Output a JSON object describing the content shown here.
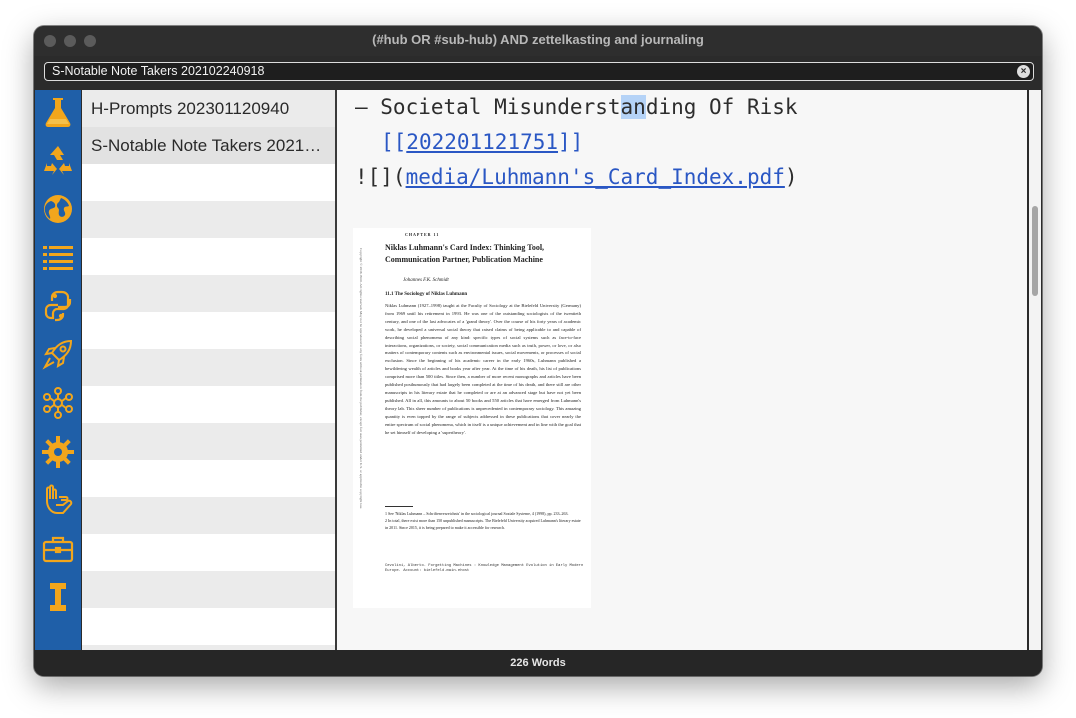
{
  "window": {
    "title": "(#hub OR #sub-hub) AND zettelkasting and journaling"
  },
  "search": {
    "value": "S-Notable Note Takers 202102240918",
    "clear_icon": "×"
  },
  "sidebar": {
    "icons": [
      "flask-icon",
      "recycle-icon",
      "globe-icon",
      "list-icon",
      "python-icon",
      "rocket-icon",
      "network-icon",
      "gear-icon",
      "hand-icon",
      "briefcase-icon",
      "letter-i-icon"
    ],
    "accent": "#1f5fa8",
    "icon_color": "#f2a61c"
  },
  "notes": {
    "items": [
      {
        "label": "H-Prompts 202301120940"
      },
      {
        "label": "S-Notable Note Takers 202102240918"
      }
    ]
  },
  "editor": {
    "line1_prefix": "– Societal Misunderst",
    "line1_selected": "an",
    "line1_suffix": "ding Of Risk",
    "line2_open": "[[",
    "line2_link": "202201121751",
    "line2_close": "]]",
    "line3_prefix": "![](",
    "line3_link": "media/Luhmann's_Card_Index.pdf",
    "line3_suffix": ")",
    "pdf": {
      "chapter": "CHAPTER 11",
      "title": "Niklas Luhmann's Card Index: Thinking Tool, Communication Partner, Publication Machine",
      "author": "Johannes F.K. Schmidt",
      "section": "11.1      The Sociology of Niklas Luhmann",
      "body": "Niklas Luhmann (1927–1998) taught at the Faculty of Sociology at the Bielefeld University (Germany) from 1969 until his retirement in 1993. He was one of the outstanding sociologists of the twentieth century, and one of the last advocates of a 'grand theory'. Over the course of his forty years of academic work, he developed a universal social theory that raised claims of being applicable to and capable of describing social phenomena of any kind: specific types of social systems such as face-to-face interactions, organizations, or society, social communication media such as truth, power, or love, or also matters of contemporary contents such as environmental issues, social movements, or processes of social exclusion. Since the beginning of his academic career in the early 1960s, Luhmann published a bewildering wealth of articles and books year after year. At the time of his death, his list of publications comprised more than 500 titles. Since then, a number of more recent monographs and articles have been published posthumously that had largely been completed at the time of his death, and there still are other manuscripts in his literary estate that he completed or are at an advanced stage but have not yet been published. All in all, this amounts to about 50 books and 550 articles that have emerged from Luhmann's theory lab. This sheer number of publications is unprecedented in contemporary sociology. This amazing quantity is even topped by the range of subjects addressed in these publications that cover nearly the entire spectrum of social phenomena, which in itself is a unique achievement and in line with the goal that he set himself of developing a 'supertheory'.",
      "footnote1": "1   See 'Niklas Luhmann – Schriftenverzeichnis' in the sociological journal Soziale Systeme, 4 (1998), pp. 233–263.",
      "footnote2": "2   In total, there exist more than 150 unpublished manuscripts. The Bielefeld University acquired Luhmann's literary estate in 2011. Since 2015, it is being prepared to make it accessible for research.",
      "side_note": "Copyright © 2016. Brill. All rights reserved. May not be reproduced in any form without permission from the publisher, except fair uses permitted under U.S. or applicable copyright law.",
      "footer": "Cevolini, Alberto. Forgetting Machines : Knowledge Management Evolution in Early Modern Europe. Account: bielefeld.main.ehost"
    }
  },
  "status": {
    "word_count": "226 Words"
  }
}
